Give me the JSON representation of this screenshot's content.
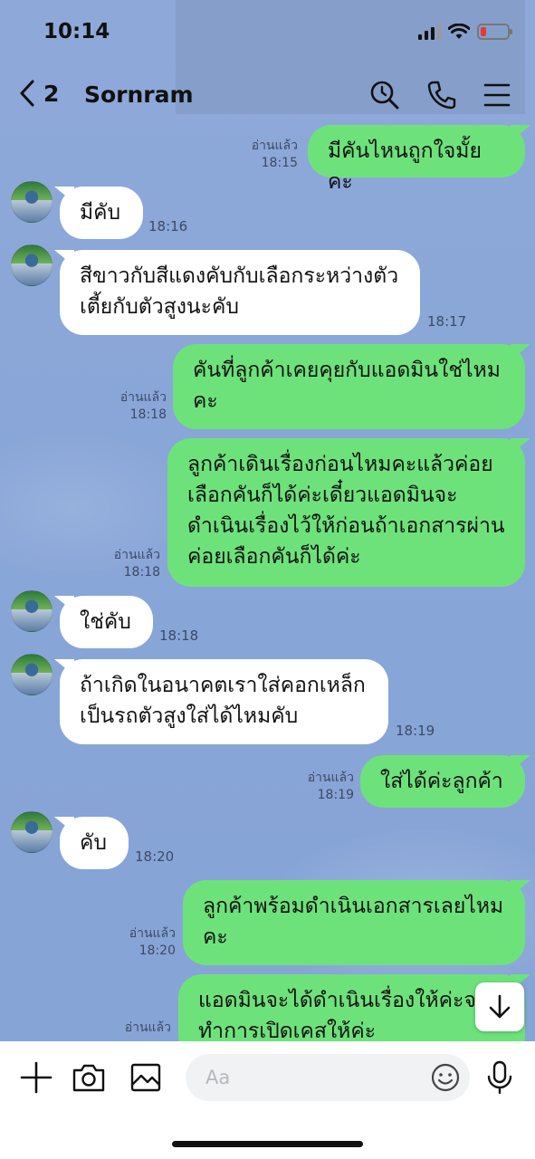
{
  "status_bar": {
    "time": "10:14"
  },
  "header": {
    "back_count": "2",
    "contact_name": "Sornram"
  },
  "messages": [
    {
      "dir": "out",
      "text": "มีคันไหนถูกใจมั้ยคะ",
      "read": "อ่านแล้ว",
      "time": "18:15"
    },
    {
      "dir": "in",
      "text": "มีคับ",
      "time": "18:16"
    },
    {
      "dir": "in",
      "text": "สีขาวกับสีแดงคับกับเลือกระหว่างตัว\nเตี้ยกับตัวสูงนะคับ",
      "time": "18:17"
    },
    {
      "dir": "out",
      "text": "คันที่ลูกค้าเคยคุยกับแอดมินใช่ไหม\nคะ",
      "read": "อ่านแล้ว",
      "time": "18:18"
    },
    {
      "dir": "out",
      "text": "ลูกค้าเดินเรื่องก่อนไหมคะแล้วค่อย\nเลือกคันก็ได้ค่ะเดี๋ยวแอดมินจะ\nดำเนินเรื่องไว้ให้ก่อนถ้าเอกสารผ่าน\nค่อยเลือกคันก็ได้ค่ะ",
      "read": "อ่านแล้ว",
      "time": "18:18"
    },
    {
      "dir": "in",
      "text": "ใช่คับ",
      "time": "18:18"
    },
    {
      "dir": "in",
      "text": "ถ้าเกิดในอนาคตเราใส่คอกเหล็ก\nเป็นรถตัวสูงใส่ได้ไหมคับ",
      "time": "18:19"
    },
    {
      "dir": "out",
      "text": "ใส่ได้ค่ะลูกค้า",
      "read": "อ่านแล้ว",
      "time": "18:19"
    },
    {
      "dir": "in",
      "text": "คับ",
      "time": "18:20"
    },
    {
      "dir": "out",
      "text": "ลูกค้าพร้อมดำเนินเอกสารเลยไหม\nคะ",
      "read": "อ่านแล้ว",
      "time": "18:20"
    },
    {
      "dir": "out",
      "text": "แอดมินจะได้ดำเนินเรื่องให้ค่ะจะ\nทำการเปิดเคสให้ค่ะ",
      "read": "อ่านแล้ว",
      "time": ""
    }
  ],
  "input": {
    "placeholder": "Aa"
  },
  "icons": {
    "back": "chevron-left-icon",
    "search": "search-icon",
    "call": "phone-icon",
    "menu": "menu-icon",
    "add": "plus-icon",
    "camera": "camera-icon",
    "gallery": "image-icon",
    "emoji": "emoji-icon",
    "mic": "microphone-icon",
    "scroll_down": "arrow-down-icon"
  },
  "colors": {
    "outgoing_bubble": "#6de27b",
    "incoming_bubble": "#ffffff",
    "chat_background": "#8aa7d8"
  }
}
